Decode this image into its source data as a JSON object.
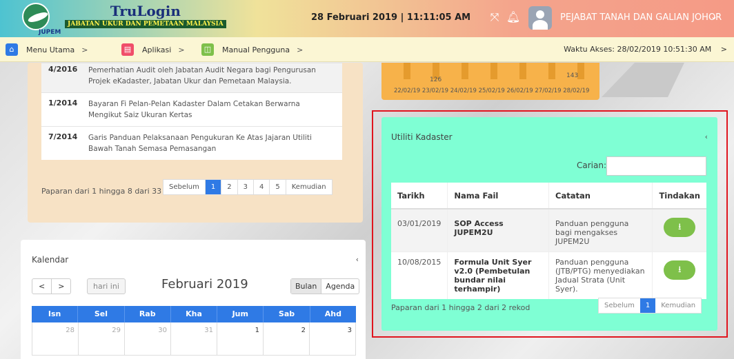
{
  "header": {
    "logo_text": "JUPEM",
    "brand_title": "TruLogin",
    "brand_subtitle": "JABATAN UKUR DAN PEMETAAN MALAYSIA",
    "datetime": "28 Februari 2019 | 11:11:05 AM",
    "user_name": "PEJABAT TANAH DAN GALIAN JOHOR"
  },
  "nav": {
    "items": [
      {
        "label": "Menu Utama",
        "icon": "home-icon",
        "color": "#2f7ae5"
      },
      {
        "label": "Aplikasi",
        "icon": "app-icon",
        "color": "#f04e6a"
      },
      {
        "label": "Manual Pengguna",
        "icon": "book-icon",
        "color": "#7ec04a"
      }
    ],
    "waktu": "Waktu Akses: 28/02/2019 10:51:30 AM"
  },
  "circulars": [
    {
      "no": "4/2016",
      "desc": "Pemerhatian Audit oleh Jabatan Audit Negara bagi Pengurusan Projek eKadaster, Jabatan Ukur dan Pemetaan Malaysia."
    },
    {
      "no": "1/2014",
      "desc": "Bayaran Fi Pelan-Pelan Kadaster Dalam Cetakan Berwarna Mengikut Saiz Ukuran Kertas"
    },
    {
      "no": "7/2014",
      "desc": "Garis Panduan Pelaksanaan Pengukuran Ke Atas Jajaran Utiliti Bawah Tanah Semasa Pemasangan"
    }
  ],
  "circ_footer": "Paparan dari 1 hingga 8 dari 33 r",
  "circ_pager": {
    "prev": "Sebelum",
    "pages": [
      "1",
      "2",
      "3",
      "4",
      "5"
    ],
    "next": "Kemudian"
  },
  "chart": {
    "label_a": "126",
    "label_b": "143",
    "dates": "22/02/19 23/02/19 24/02/19 25/02/19 26/02/19 27/02/19 28/02/19"
  },
  "kalendar": {
    "title": "Kalendar",
    "today": "hari ini",
    "month": "Februari 2019",
    "views": [
      "Bulan",
      "Agenda"
    ],
    "days": [
      "Isn",
      "Sel",
      "Rab",
      "Kha",
      "Jum",
      "Sab",
      "Ahd"
    ],
    "week1": [
      "28",
      "29",
      "30",
      "31",
      "1",
      "2",
      "3"
    ]
  },
  "utiliti": {
    "title": "Utiliti Kadaster",
    "search_label": "Carian:",
    "columns": [
      "Tarikh",
      "Nama Fail",
      "Catatan",
      "Tindakan"
    ],
    "rows": [
      {
        "tarikh": "03/01/2019",
        "nama": "SOP Access JUPEM2U",
        "catatan": "Panduan pengguna bagi mengakses JUPEM2U"
      },
      {
        "tarikh": "10/08/2015",
        "nama": "Formula Unit Syer v2.0 (Pembetulan bundar nilai terhampir)",
        "catatan": "Panduan pengguna (JTB/PTG) menyediakan Jadual Strata (Unit Syer)."
      }
    ],
    "footer": "Paparan dari 1 hingga 2 dari 2 rekod",
    "pager": {
      "prev": "Sebelum",
      "page": "1",
      "next": "Kemudian"
    }
  }
}
